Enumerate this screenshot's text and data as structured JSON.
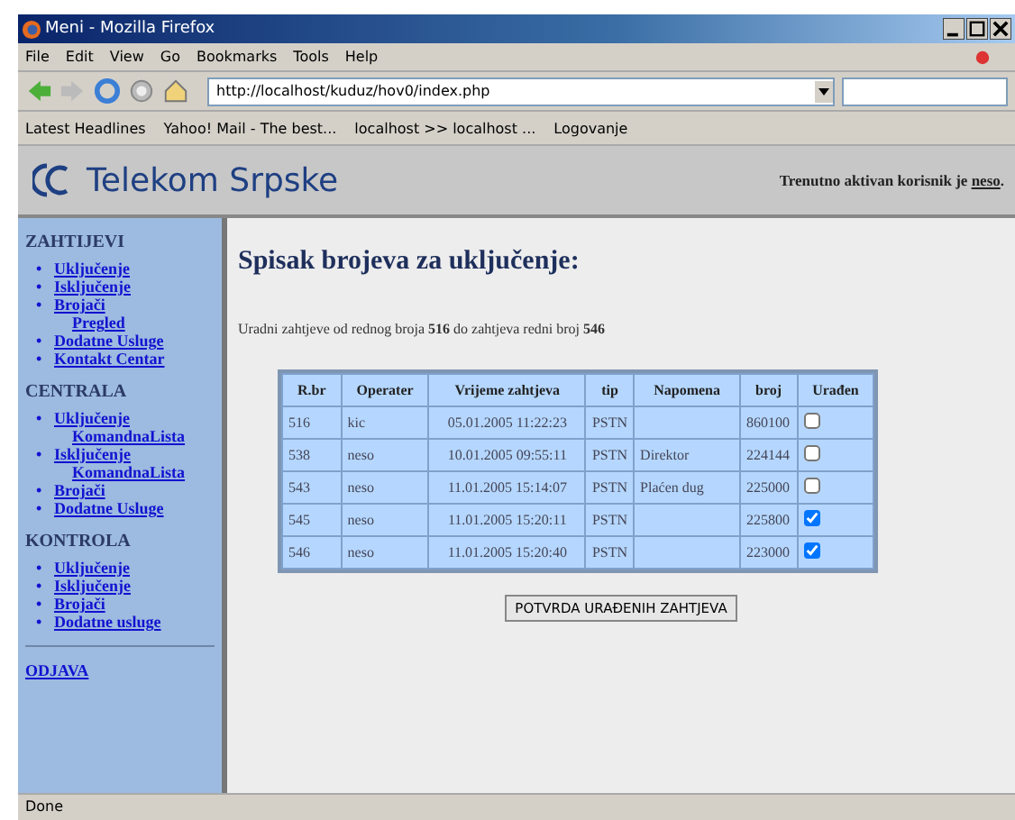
{
  "window": {
    "title": "Meni - Mozilla Firefox"
  },
  "menu": [
    "File",
    "Edit",
    "View",
    "Go",
    "Bookmarks",
    "Tools",
    "Help"
  ],
  "address": {
    "value": "http://localhost/kuduz/hov0/index.php"
  },
  "bookmarks": [
    "Latest Headlines",
    "Yahoo! Mail - The best...",
    "localhost >> localhost ...",
    "Logovanje"
  ],
  "header": {
    "logo": "Telekom Srpske",
    "user_text": "Trenutno aktivan korisnik je ",
    "user": "neso",
    "user_end": "."
  },
  "sidebar": [
    {
      "heading": "ZAHTIJEVI",
      "items": [
        {
          "label": "Uključenje"
        },
        {
          "label": "Isključenje"
        },
        {
          "label": "Brojači",
          "children": [
            {
              "label": "Pregled"
            }
          ]
        },
        {
          "label": "Dodatne Usluge"
        },
        {
          "label": "Kontakt Centar"
        }
      ]
    },
    {
      "heading": "CENTRALA",
      "items": [
        {
          "label": "Uključenje",
          "children": [
            {
              "label": "KomandnaLista"
            }
          ]
        },
        {
          "label": "Isključenje",
          "children": [
            {
              "label": "KomandnaLista"
            }
          ]
        },
        {
          "label": "Brojači"
        },
        {
          "label": "Dodatne Usluge"
        }
      ]
    },
    {
      "heading": "KONTROLA",
      "items": [
        {
          "label": "Uključenje"
        },
        {
          "label": "Isključenje"
        },
        {
          "label": "Brojači"
        },
        {
          "label": "Dodatne usluge"
        }
      ]
    }
  ],
  "bullet": "•",
  "logout": "ODJAVA",
  "title": "Spisak brojeva za uključenje:",
  "summary": "Uradni zahtjeve od rednog broja **516** do zahtjeva redni broj **546**",
  "table": {
    "columns": [
      "R.br",
      "Operater",
      "Vrijeme zahtjeva",
      "tip",
      "Napomena",
      "broj",
      "Urađen"
    ],
    "rows": [
      {
        "cells": [
          "516",
          "kic",
          "05.01.2005 11:22:23",
          "PSTN",
          "",
          "860100"
        ],
        "checked": false
      },
      {
        "cells": [
          "538",
          "neso",
          "10.01.2005 09:55:11",
          "PSTN",
          "Direktor",
          "224144"
        ],
        "checked": false
      },
      {
        "cells": [
          "543",
          "neso",
          "11.01.2005 15:14:07",
          "PSTN",
          "Plaćen dug",
          "225000"
        ],
        "checked": false
      },
      {
        "cells": [
          "545",
          "neso",
          "11.01.2005 15:20:11",
          "PSTN",
          "",
          "225800"
        ],
        "checked": true
      },
      {
        "cells": [
          "546",
          "neso",
          "11.01.2005 15:20:40",
          "PSTN",
          "",
          "223000"
        ],
        "checked": true
      }
    ]
  },
  "submit": "POTVRDA URAĐENIH ZAHTJEVA",
  "status_bar": "Done"
}
